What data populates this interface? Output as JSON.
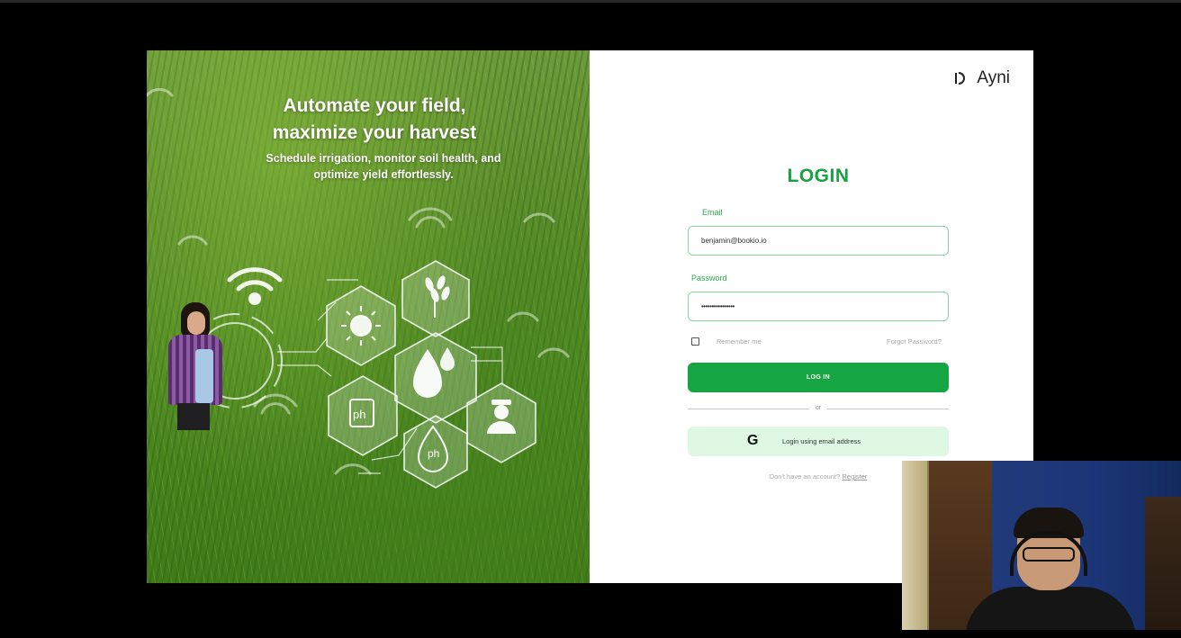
{
  "hero": {
    "title_line1": "Automate your field,",
    "title_line2": "maximize your harvest",
    "subtitle_line1": "Schedule irrigation, monitor soil health, and",
    "subtitle_line2": "optimize yield effortlessly.",
    "hex_labels": {
      "ph_sensor": "ph",
      "ph_drop": "ph"
    }
  },
  "brand": {
    "name": "Ayni",
    "logo_icon": "ayni-logo-icon"
  },
  "login": {
    "title": "LOGIN",
    "email_label": "Email",
    "email_value": "benjamin@bookio.io",
    "password_label": "Password",
    "password_value": "••••••••••••••••",
    "remember_label": "Remember me",
    "forgot_label": "Forgot Password?",
    "login_button": "LOG IN",
    "or_text": "or",
    "google_icon": "G",
    "google_label": "Login using email address",
    "signup_text": "Don't have an account?",
    "register_link": "Register"
  },
  "colors": {
    "accent": "#16a543",
    "input_border": "#8ad4a3",
    "google_bg": "#def8e4"
  }
}
